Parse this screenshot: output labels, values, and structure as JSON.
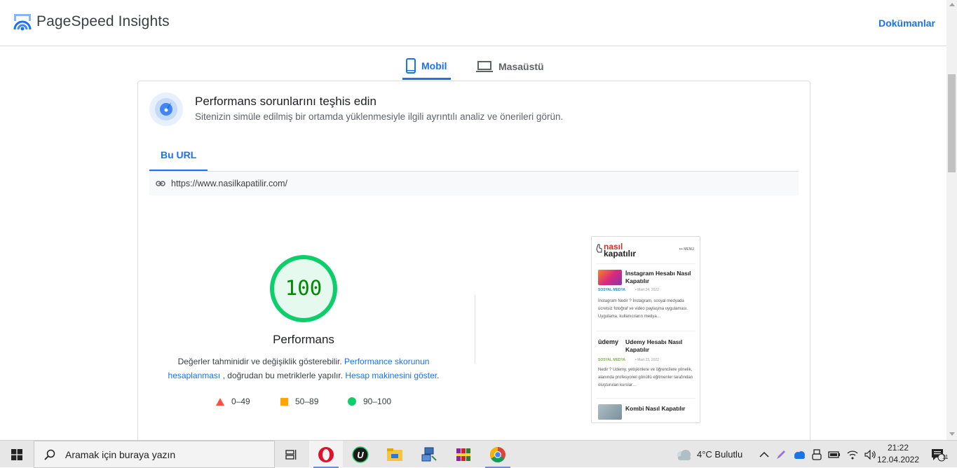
{
  "header": {
    "title": "PageSpeed Insights",
    "docs_label": "Dokümanlar"
  },
  "device_tabs": {
    "mobile": "Mobil",
    "desktop": "Masaüstü"
  },
  "diagnose": {
    "title": "Performans sorunlarını teşhis edin",
    "subtitle": "Sitenizin simüle edilmiş bir ortamda yüklenmesiyle ilgili ayrıntılı analiz ve önerileri görün.",
    "tab_label": "Bu URL",
    "url": "https://www.nasilkapatilir.com/"
  },
  "score": {
    "value": "100",
    "label": "Performans",
    "desc_1": "Değerler tahminidir ve değişiklik gösterebilir.",
    "link_1a": "Performance skorunun",
    "link_1b": "hesaplanması",
    "desc_2": ", doğrudan bu metriklerle yapılır.",
    "link_2": "Hesap makinesini göster",
    "desc_3": "."
  },
  "legend": {
    "fail": "0–49",
    "average": "50–89",
    "pass": "90–100"
  },
  "colors": {
    "accent": "#1a73e8",
    "pass": "#0cce6b",
    "average": "#ffa400",
    "fail": "#ff4e42"
  },
  "preview": {
    "brand_top": "nasıl",
    "brand_bottom": "kapatılır",
    "menu": "••• MENU",
    "items": [
      {
        "title": "İnstagram Hesabı Nasıl Kapatılır",
        "category": "SOSYAL MEDYA",
        "date": "• Mart 24, 2022",
        "text": "İnstagram Nedir ? İnstagram, sosyal medyada ücretsiz fotoğraf ve video paylaşma uygulaması. Uygulama, kullanıcıların medya…"
      },
      {
        "title": "Udemy Hesabı Nasıl Kapatılır",
        "category": "SOSYAL MEDYA",
        "date": "• Mart 23, 2022",
        "text": " Nedir ? Udemy, yetişkinlere ve öğrencilere yönelik, alanında profesyonel gönüllü eğitmenler tarafından oluşturulan kurslar…"
      },
      {
        "title": "Kombi Nasıl Kapatılır"
      }
    ],
    "udemy_logo": "ûdemy"
  },
  "taskbar": {
    "search_placeholder": "Aramak için buraya yazın",
    "weather": "4°C  Bulutlu",
    "time": "21:22",
    "date": "12.04.2022",
    "notification_count": "11"
  }
}
